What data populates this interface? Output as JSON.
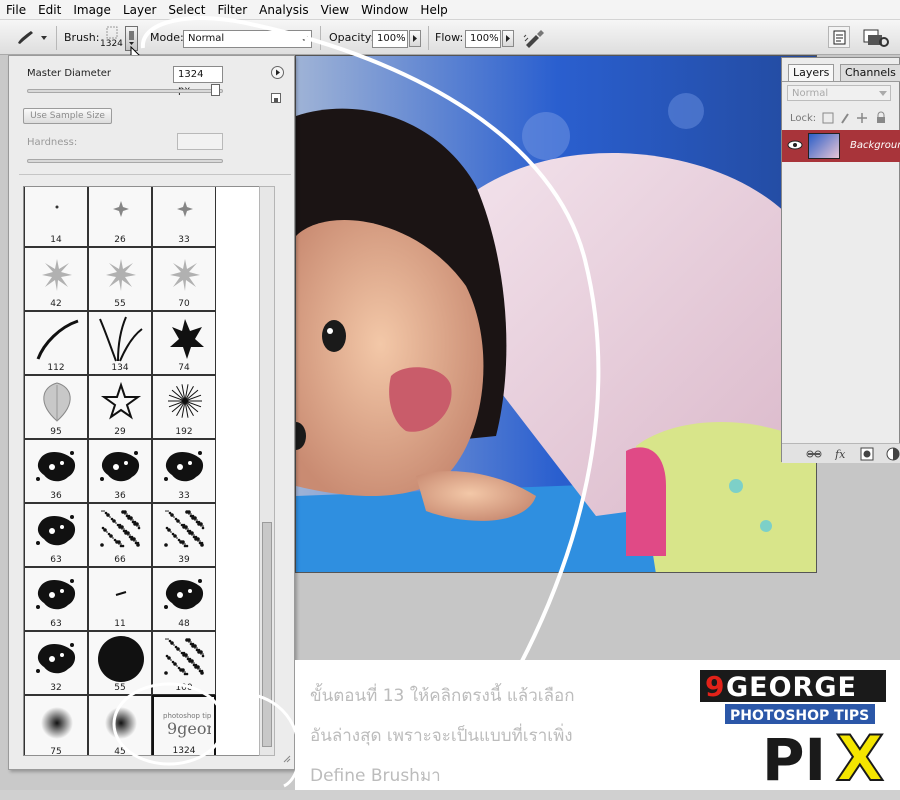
{
  "menu": [
    "File",
    "Edit",
    "Image",
    "Layer",
    "Select",
    "Filter",
    "Analysis",
    "View",
    "Window",
    "Help"
  ],
  "options_bar": {
    "tool_icon": "brush-icon",
    "brush_label": "Brush:",
    "brush_size": "1324",
    "mode_label": "Mode:",
    "mode_value": "Normal",
    "opacity_label": "Opacity:",
    "opacity_value": "100%",
    "flow_label": "Flow:",
    "flow_value": "100%"
  },
  "brush_picker": {
    "diameter_label": "Master Diameter",
    "diameter_value": "1324 px",
    "sample_button": "Use Sample Size",
    "hardness_label": "Hardness:",
    "presets": [
      "14",
      "26",
      "33",
      "42",
      "55",
      "70",
      "112",
      "134",
      "74",
      "95",
      "29",
      "192",
      "36",
      "36",
      "33",
      "63",
      "66",
      "39",
      "63",
      "11",
      "48",
      "32",
      "55",
      "100",
      "75",
      "45",
      "1324"
    ]
  },
  "layers_panel": {
    "tabs": [
      "Layers",
      "Channels"
    ],
    "blend_mode": "Normal",
    "lock_label": "Lock:",
    "layer_name": "Background"
  },
  "caption": {
    "line1": "ขั้นตอนที่ 13 ให้คลิกตรงนี้  แล้วเลือก",
    "line2": "อันล่างสุด เพราะจะเป็นแบบที่เราเพิ่ง",
    "line3": "Define Brushมา"
  },
  "logo": {
    "brand": "9GEORGE",
    "tagline": "PHOTOSHOP TIPS",
    "word": "PIX"
  },
  "colors": {
    "accent_layer_bg": "#a8343a",
    "logo_yellow": "#f4e500",
    "logo_red": "#e32219",
    "logo_blue": "#2b57a8"
  }
}
